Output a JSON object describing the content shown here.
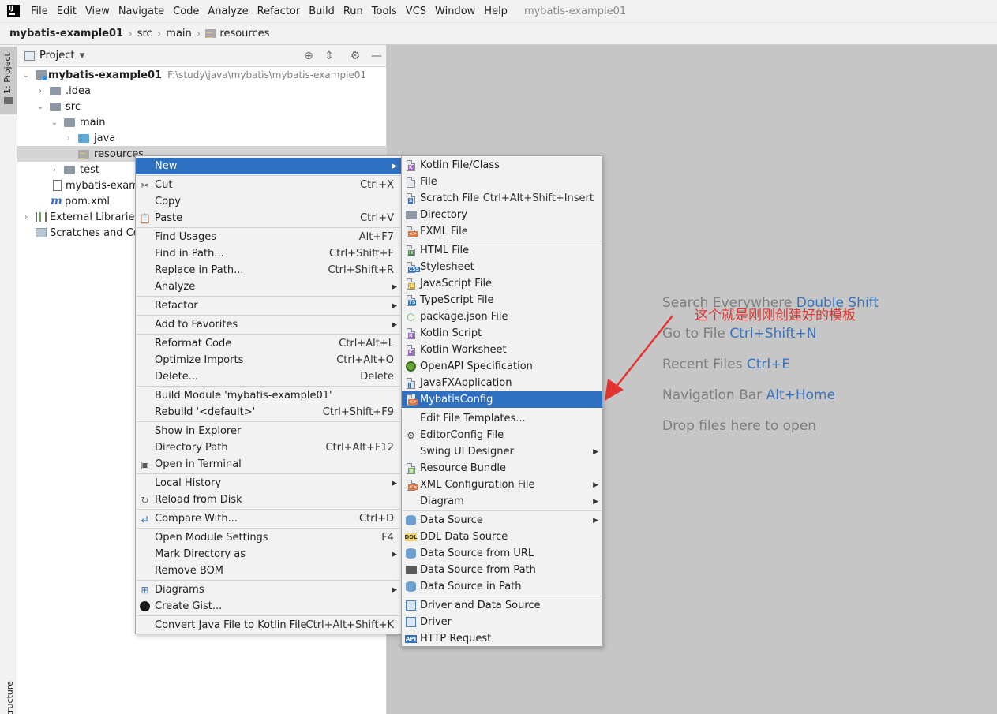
{
  "menubar": {
    "items": [
      "File",
      "Edit",
      "View",
      "Navigate",
      "Code",
      "Analyze",
      "Refactor",
      "Build",
      "Run",
      "Tools",
      "VCS",
      "Window",
      "Help"
    ],
    "window_title": "mybatis-example01"
  },
  "breadcrumb": {
    "items": [
      "mybatis-example01",
      "src",
      "main",
      "resources"
    ]
  },
  "left_strip": {
    "project_tab": "1: Project",
    "structure_tab": "Z: Structure"
  },
  "project_panel": {
    "title": "Project",
    "tree": {
      "root_label": "mybatis-example01",
      "root_path": "F:\\study\\java\\mybatis\\mybatis-example01",
      "idea": ".idea",
      "src": "src",
      "main": "main",
      "java": "java",
      "resources": "resources",
      "test": "test",
      "iml": "mybatis-examp",
      "pom": "pom.xml",
      "external_libraries": "External Libraries",
      "scratches": "Scratches and Cor"
    }
  },
  "context_menu": {
    "items": [
      {
        "label": "New",
        "shortcut": "",
        "submenu": true,
        "highlighted": true
      },
      {
        "label": "Cut",
        "shortcut": "Ctrl+X",
        "icon": "scissors-icon"
      },
      {
        "label": "Copy",
        "shortcut": "",
        "submenu": true
      },
      {
        "label": "Paste",
        "shortcut": "Ctrl+V",
        "icon": "clipboard-icon"
      },
      {
        "label": "Find Usages",
        "shortcut": "Alt+F7"
      },
      {
        "label": "Find in Path...",
        "shortcut": "Ctrl+Shift+F"
      },
      {
        "label": "Replace in Path...",
        "shortcut": "Ctrl+Shift+R"
      },
      {
        "label": "Analyze",
        "shortcut": "",
        "submenu": true
      },
      {
        "label": "Refactor",
        "shortcut": "",
        "submenu": true
      },
      {
        "label": "Add to Favorites",
        "shortcut": "",
        "submenu": true
      },
      {
        "label": "Reformat Code",
        "shortcut": "Ctrl+Alt+L"
      },
      {
        "label": "Optimize Imports",
        "shortcut": "Ctrl+Alt+O"
      },
      {
        "label": "Delete...",
        "shortcut": "Delete"
      },
      {
        "label": "Build Module 'mybatis-example01'",
        "shortcut": ""
      },
      {
        "label": "Rebuild '<default>'",
        "shortcut": "Ctrl+Shift+F9"
      },
      {
        "label": "Show in Explorer",
        "shortcut": ""
      },
      {
        "label": "Directory Path",
        "shortcut": "Ctrl+Alt+F12"
      },
      {
        "label": "Open in Terminal",
        "shortcut": "",
        "icon": "terminal-icon"
      },
      {
        "label": "Local History",
        "shortcut": "",
        "submenu": true
      },
      {
        "label": "Reload from Disk",
        "shortcut": "",
        "icon": "reload-icon"
      },
      {
        "label": "Compare With...",
        "shortcut": "Ctrl+D",
        "icon": "compare-icon"
      },
      {
        "label": "Open Module Settings",
        "shortcut": "F4"
      },
      {
        "label": "Mark Directory as",
        "shortcut": "",
        "submenu": true
      },
      {
        "label": "Remove BOM",
        "shortcut": ""
      },
      {
        "label": "Diagrams",
        "shortcut": "",
        "submenu": true,
        "icon": "diagram-icon"
      },
      {
        "label": "Create Gist...",
        "shortcut": "",
        "icon": "github-icon"
      },
      {
        "label": "Convert Java File to Kotlin File",
        "shortcut": "Ctrl+Alt+Shift+K"
      }
    ]
  },
  "new_submenu": {
    "items": [
      {
        "label": "Kotlin File/Class",
        "shortcut": "",
        "icon": "kotlin-file-icon"
      },
      {
        "label": "File",
        "shortcut": "",
        "icon": "file-icon"
      },
      {
        "label": "Scratch File",
        "shortcut": "Ctrl+Alt+Shift+Insert",
        "icon": "scratch-file-icon"
      },
      {
        "label": "Directory",
        "shortcut": "",
        "icon": "folder-icon"
      },
      {
        "label": "FXML File",
        "shortcut": "",
        "icon": "fxml-file-icon"
      },
      {
        "label": "HTML File",
        "shortcut": "",
        "icon": "html-file-icon"
      },
      {
        "label": "Stylesheet",
        "shortcut": "",
        "icon": "css-file-icon"
      },
      {
        "label": "JavaScript File",
        "shortcut": "",
        "icon": "js-file-icon"
      },
      {
        "label": "TypeScript File",
        "shortcut": "",
        "icon": "ts-file-icon"
      },
      {
        "label": "package.json File",
        "shortcut": "",
        "icon": "nodejs-icon"
      },
      {
        "label": "Kotlin Script",
        "shortcut": "",
        "icon": "kotlin-script-icon"
      },
      {
        "label": "Kotlin Worksheet",
        "shortcut": "",
        "icon": "kotlin-worksheet-icon"
      },
      {
        "label": "OpenAPI Specification",
        "shortcut": "",
        "icon": "openapi-icon"
      },
      {
        "label": "JavaFXApplication",
        "shortcut": "",
        "icon": "javafx-icon"
      },
      {
        "label": "MybatisConfig",
        "shortcut": "",
        "icon": "xml-template-icon",
        "highlighted": true
      },
      {
        "label": "Edit File Templates...",
        "shortcut": ""
      },
      {
        "label": "EditorConfig File",
        "shortcut": "",
        "icon": "gear-icon"
      },
      {
        "label": "Swing UI Designer",
        "shortcut": "",
        "submenu": true
      },
      {
        "label": "Resource Bundle",
        "shortcut": "",
        "icon": "resource-bundle-icon"
      },
      {
        "label": "XML Configuration File",
        "shortcut": "",
        "submenu": true,
        "icon": "xml-file-icon"
      },
      {
        "label": "Diagram",
        "shortcut": "",
        "submenu": true
      },
      {
        "label": "Data Source",
        "shortcut": "",
        "submenu": true,
        "icon": "database-icon"
      },
      {
        "label": "DDL Data Source",
        "shortcut": "",
        "icon": "ddl-icon"
      },
      {
        "label": "Data Source from URL",
        "shortcut": "",
        "icon": "database-icon"
      },
      {
        "label": "Data Source from Path",
        "shortcut": "",
        "icon": "folder-open-icon"
      },
      {
        "label": "Data Source in Path",
        "shortcut": "",
        "icon": "database-icon"
      },
      {
        "label": "Driver and Data Source",
        "shortcut": "",
        "icon": "driver-icon"
      },
      {
        "label": "Driver",
        "shortcut": "",
        "icon": "driver-icon"
      },
      {
        "label": "HTTP Request",
        "shortcut": "",
        "icon": "api-icon"
      }
    ]
  },
  "editor_hints": [
    {
      "text": "Search Everywhere",
      "shortcut": "Double Shift"
    },
    {
      "text": "Go to File",
      "shortcut": "Ctrl+Shift+N"
    },
    {
      "text": "Recent Files",
      "shortcut": "Ctrl+E"
    },
    {
      "text": "Navigation Bar",
      "shortcut": "Alt+Home"
    },
    {
      "text": "Drop files here to open",
      "shortcut": ""
    }
  ],
  "annotation": {
    "text": "这个就是刚刚创建好的模板",
    "color": "#e3342f"
  },
  "colors": {
    "highlight": "#2f6fbf",
    "shortcut_blue": "#3a73bd",
    "editor_bg": "#c6c6c6"
  }
}
